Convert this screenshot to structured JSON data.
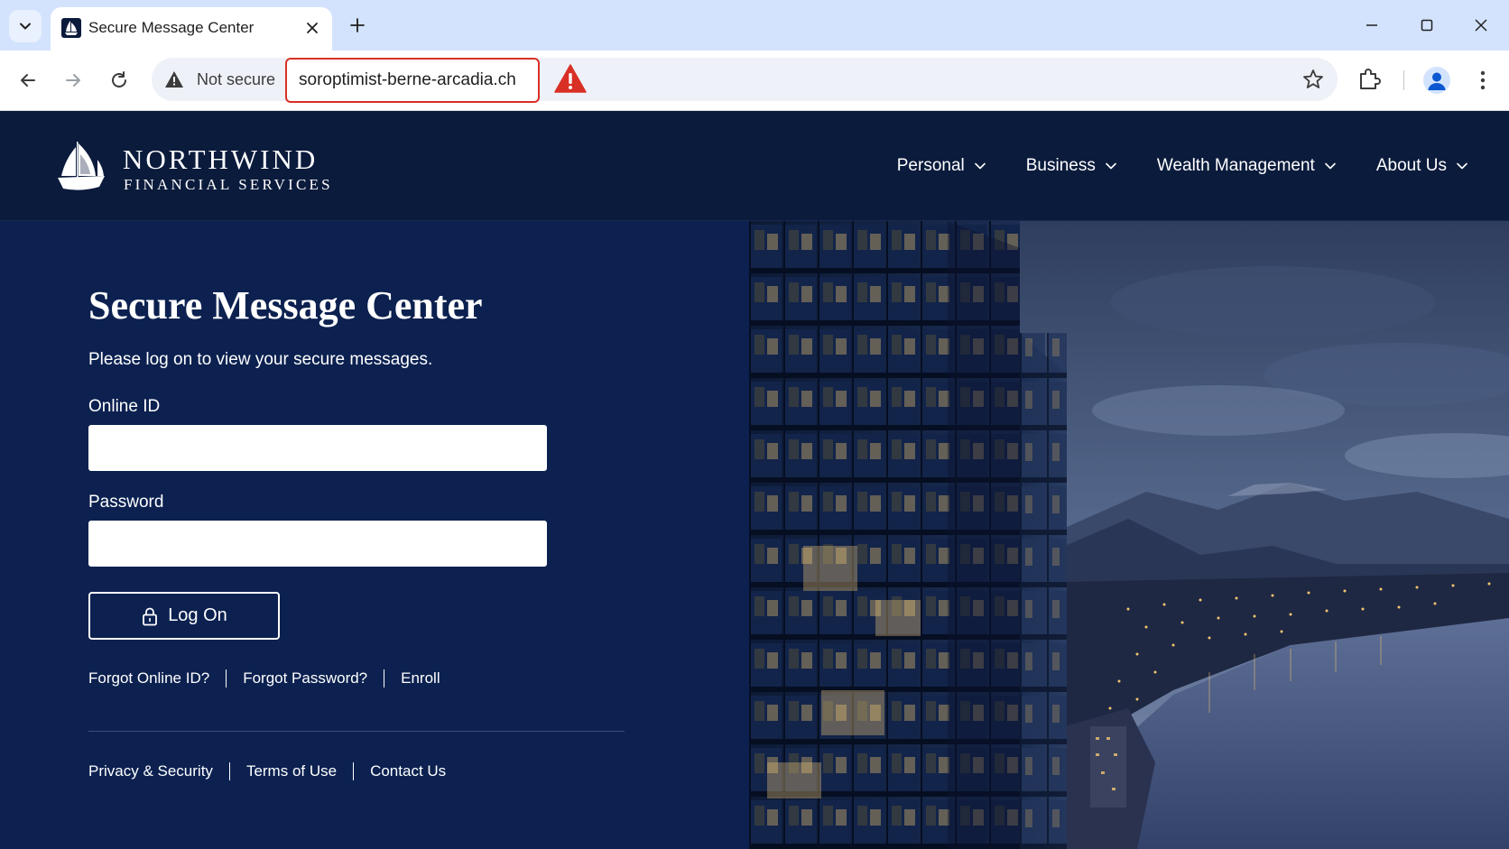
{
  "browser": {
    "tab_title": "Secure Message Center",
    "security_label": "Not secure",
    "url": "soroptimist-berne-arcadia.ch",
    "colors": {
      "warning": "#d93025",
      "tabstrip": "#d3e3fd"
    }
  },
  "site": {
    "logo": {
      "name": "NORTHWIND",
      "subtitle": "FINANCIAL SERVICES"
    },
    "nav": [
      {
        "label": "Personal"
      },
      {
        "label": "Business"
      },
      {
        "label": "Wealth Management"
      },
      {
        "label": "About Us"
      }
    ],
    "colors": {
      "header_bg": "#0b1b3c",
      "content_bg": "#0c2150"
    }
  },
  "login": {
    "title": "Secure Message Center",
    "intro": "Please log on to view your secure messages.",
    "online_id_label": "Online ID",
    "online_id_value": "",
    "password_label": "Password",
    "password_value": "",
    "logon_label": "Log On",
    "help_links": [
      {
        "label": "Forgot Online ID?"
      },
      {
        "label": "Forgot Password?"
      },
      {
        "label": "Enroll"
      }
    ]
  },
  "footer": {
    "links": [
      {
        "label": "Privacy & Security"
      },
      {
        "label": "Terms of Use"
      },
      {
        "label": "Contact Us"
      }
    ]
  }
}
